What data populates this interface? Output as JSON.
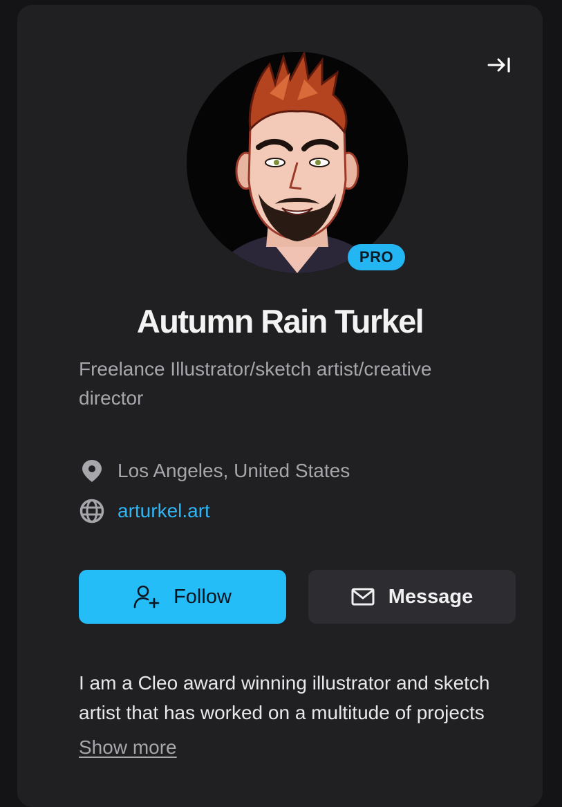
{
  "profile": {
    "name": "Autumn Rain Turkel",
    "badge": "PRO",
    "headline": "Freelance Illustrator/sketch artist/creative director",
    "location": "Los Angeles, United States",
    "website": "arturkel.art",
    "bio": "I am a Cleo award winning illustrator and sketch artist that has worked on a multitude of projects",
    "show_more_label": "Show more"
  },
  "actions": {
    "follow_label": "Follow",
    "message_label": "Message"
  },
  "icons": {
    "collapse": "collapse-panel-icon",
    "location": "map-pin-icon",
    "website": "globe-icon",
    "follow": "user-plus-icon",
    "message": "envelope-icon"
  },
  "colors": {
    "accent": "#24bdf8",
    "card_bg": "#202023",
    "page_bg": "#141417",
    "secondary_button": "#2d2d31",
    "link": "#2eb6f5",
    "muted_text": "#a6a6ab"
  }
}
